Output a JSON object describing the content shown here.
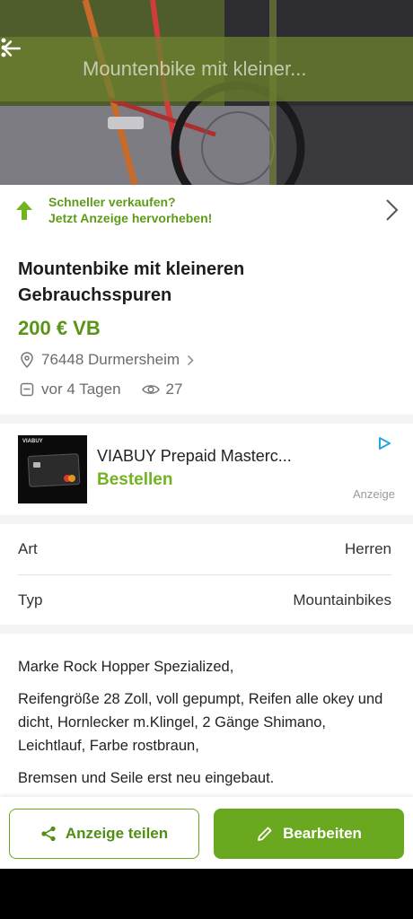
{
  "appbar": {
    "title": "Mountenbike  mit kleiner...",
    "back_icon": "arrow-left-icon",
    "menu_icon": "more-vertical-icon"
  },
  "promo": {
    "line1": "Schneller verkaufen?",
    "line2": "Jetzt Anzeige hervorheben!"
  },
  "listing": {
    "title": "Mountenbike  mit kleineren Gebrauchsspuren",
    "price": "200 € VB",
    "location": "76448 Durmersheim",
    "posted": "vor 4 Tagen",
    "views": "27"
  },
  "ad": {
    "name": "VIABUY Prepaid Masterc...",
    "cta": "Bestellen",
    "label": "Anzeige",
    "card_brand": "VIABUY"
  },
  "attributes": [
    {
      "key": "Art",
      "value": "Herren"
    },
    {
      "key": "Typ",
      "value": "Mountainbikes"
    }
  ],
  "description": [
    "Marke Rock Hopper Spezialized,",
    "Reifengröße 28 Zoll, voll gepumpt, Reifen alle okey und dicht, Hornlecker m.Klingel, 2 Gänge Shimano, Leichtlauf, Farbe rostbraun,",
    "Bremsen und Seile erst neu eingebaut."
  ],
  "actions": {
    "share_label": "Anzeige teilen",
    "edit_label": "Bearbeiten"
  },
  "colors": {
    "accent": "#6aa820",
    "price": "#5a9417",
    "appbar": "#6b802e"
  }
}
